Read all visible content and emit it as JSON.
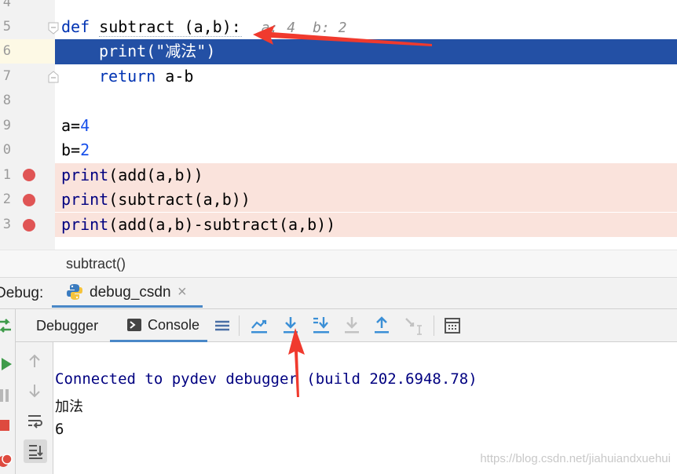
{
  "editor": {
    "line_numbers": [
      "4",
      "5",
      "6",
      "7",
      "8",
      "9",
      "0",
      "1",
      "2",
      "3"
    ],
    "lines": {
      "def_kw": "def",
      "def_rest": " subtract (a,b):",
      "hint_a": "a: 4",
      "hint_b": "b: 2",
      "print_kw": "print",
      "print_arg": "(\"减法\")",
      "return_kw": "return",
      "return_expr": " a-b",
      "a_name": "a=",
      "a_val": "4",
      "b_name": "b=",
      "b_val": "2",
      "call1_fn": "print",
      "call1_rest": "(add(a,b))",
      "call2_fn": "print",
      "call2_rest": "(subtract(a,b))",
      "call3_fn": "print",
      "call3_rest": "(add(a,b)-subtract(a,b))"
    }
  },
  "breadcrumb": {
    "text": "subtract()"
  },
  "debug": {
    "label": "Debug:",
    "session_tab": "debug_csdn",
    "close_glyph": "×",
    "tabs": [
      "Debugger",
      "Console"
    ]
  },
  "console": {
    "connected": "Connected to pydev debugger (build 202.6948.78)",
    "out1": "加法",
    "out2": "6"
  },
  "watermark": "https://blog.csdn.net/jiahuiandxuehui",
  "colors": {
    "selection": "#2350a5",
    "breakpoint_row": "#fae3dc",
    "breakpoint": "#e05555",
    "arrow": "#f03a2e"
  }
}
